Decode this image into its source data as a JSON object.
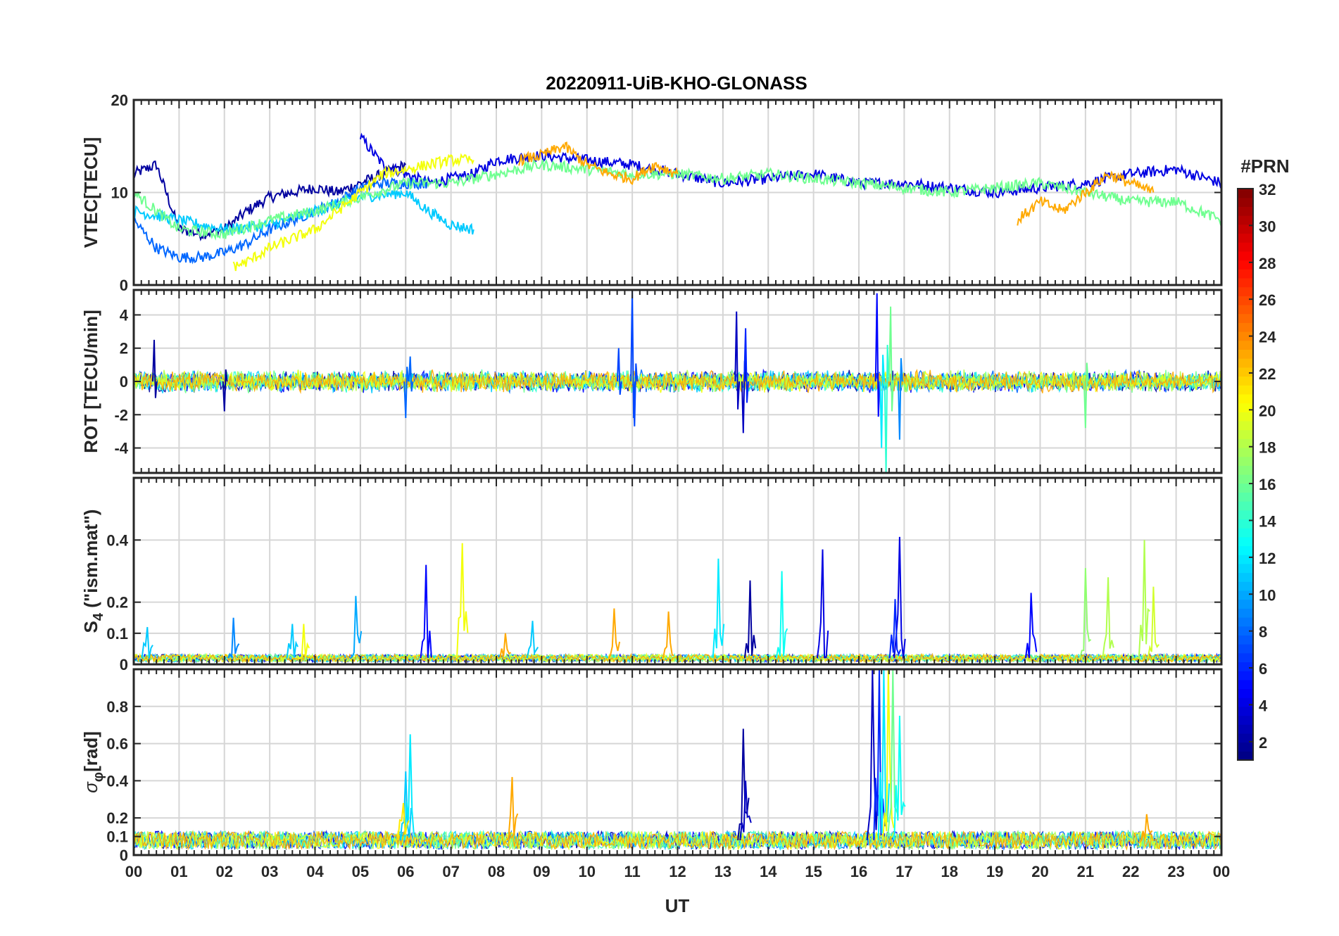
{
  "figure": {
    "title": "20220911-UiB-KHO-GLONASS",
    "xlabel": "UT",
    "x_tick_labels": [
      "00",
      "01",
      "02",
      "03",
      "04",
      "05",
      "06",
      "07",
      "08",
      "09",
      "10",
      "11",
      "12",
      "13",
      "14",
      "15",
      "16",
      "17",
      "18",
      "19",
      "20",
      "21",
      "22",
      "23",
      "00"
    ],
    "colorbar": {
      "title": "#PRN",
      "range": [
        1,
        32
      ],
      "tick_labels": [
        "2",
        "4",
        "6",
        "8",
        "10",
        "12",
        "14",
        "16",
        "18",
        "20",
        "22",
        "24",
        "26",
        "28",
        "30",
        "32"
      ],
      "colormap": "jet",
      "colors": [
        "#00008f",
        "#0000ff",
        "#0080ff",
        "#00ffff",
        "#80ff80",
        "#ffff00",
        "#ff8000",
        "#ff0000",
        "#800000"
      ]
    }
  },
  "chart_data": [
    {
      "type": "line",
      "name": "vtec",
      "ylabel": "VTEC[TECU]",
      "ylim": [
        0,
        20
      ],
      "y_ticks": [
        0,
        10,
        20
      ],
      "y_tick_labels": [
        "0",
        "10",
        "20"
      ],
      "grid": true,
      "x_unit": "hours UT",
      "series": [
        {
          "prn": 2,
          "x": [
            0,
            0.5,
            1,
            1.5,
            2,
            2.5,
            3,
            3.5,
            4,
            4.5,
            5,
            5.5,
            6
          ],
          "y": [
            12,
            13,
            6,
            5.5,
            6,
            8,
            9.5,
            10,
            10.5,
            10,
            11,
            12,
            13
          ]
        },
        {
          "prn": 4,
          "x": [
            5,
            5.5,
            6,
            6.5,
            7,
            7.5,
            8,
            9,
            10,
            11,
            12,
            13,
            14,
            15,
            16,
            17,
            18,
            19,
            20,
            21,
            22,
            23,
            24
          ],
          "y": [
            16,
            13,
            12,
            11,
            11.5,
            12,
            13.5,
            14,
            13.5,
            13,
            12,
            11,
            11.5,
            12,
            11,
            11,
            10.5,
            10,
            10.5,
            11,
            12,
            12.5,
            11
          ]
        },
        {
          "prn": 8,
          "x": [
            0,
            0.5,
            1,
            1.5,
            2,
            2.5,
            3,
            3.5,
            4,
            4.5,
            5,
            5.5,
            6,
            6.5
          ],
          "y": [
            7,
            4,
            3,
            3,
            3.5,
            4.5,
            6,
            7,
            8,
            9,
            10.5,
            11,
            11,
            11
          ]
        },
        {
          "prn": 11,
          "x": [
            0,
            1,
            2,
            3,
            4,
            5,
            6,
            6.5,
            7,
            7.5
          ],
          "y": [
            8,
            7,
            6,
            6.5,
            8,
            9.5,
            10,
            8,
            6.5,
            6
          ]
        },
        {
          "prn": 16,
          "x": [
            0,
            1,
            2,
            3,
            4,
            5,
            6,
            7,
            8,
            9,
            10,
            11,
            12,
            13,
            14,
            15,
            16,
            17,
            18,
            19,
            20,
            21,
            22,
            23,
            24
          ],
          "y": [
            10,
            6,
            5.5,
            7,
            8,
            9.5,
            11,
            11,
            12,
            13,
            12.5,
            12,
            12,
            11.5,
            12,
            11.5,
            11,
            10.5,
            10,
            10.5,
            11,
            10,
            9,
            9,
            7
          ]
        },
        {
          "prn": 20,
          "x": [
            2.2,
            2.5,
            3,
            3.5,
            4,
            4.5,
            5,
            5.5,
            6,
            6.5,
            7,
            7.5
          ],
          "y": [
            2,
            2.5,
            4,
            5,
            6,
            8,
            10,
            12,
            12.5,
            13,
            13.5,
            13.5
          ]
        },
        {
          "prn": 23,
          "x": [
            8.5,
            9,
            9.5,
            10,
            10.5,
            11,
            11.5,
            12
          ],
          "y": [
            13.5,
            14,
            15,
            13,
            12,
            11.5,
            13,
            12
          ]
        },
        {
          "prn": 23,
          "x": [
            19.5,
            20,
            20.5,
            21,
            21.5,
            22,
            22.5
          ],
          "y": [
            7,
            9,
            8,
            10,
            12,
            11,
            10
          ]
        }
      ]
    },
    {
      "type": "line",
      "name": "rot",
      "ylabel": "ROT [TECU/min]",
      "ylim": [
        -5.5,
        5.5
      ],
      "y_ticks": [
        -4,
        -2,
        0,
        2,
        4
      ],
      "y_tick_labels": [
        "-4",
        "-2",
        "0",
        "2",
        "4"
      ],
      "grid": true,
      "x_unit": "hours UT",
      "noise_amplitude": 0.45,
      "spikes": [
        {
          "x": 0.45,
          "y": 2.5,
          "prn": 2
        },
        {
          "x": 2.0,
          "y": -1.8,
          "prn": 2
        },
        {
          "x": 6.0,
          "y": -2.2,
          "prn": 8
        },
        {
          "x": 6.1,
          "y": 1.5,
          "prn": 8
        },
        {
          "x": 10.7,
          "y": 2.0,
          "prn": 7
        },
        {
          "x": 11.0,
          "y": 5.5,
          "prn": 7
        },
        {
          "x": 11.05,
          "y": -2.7,
          "prn": 7
        },
        {
          "x": 13.3,
          "y": 4.2,
          "prn": 3
        },
        {
          "x": 13.45,
          "y": -3.1,
          "prn": 3
        },
        {
          "x": 13.5,
          "y": 3.2,
          "prn": 6
        },
        {
          "x": 16.4,
          "y": 5.3,
          "prn": 5
        },
        {
          "x": 16.5,
          "y": -4.0,
          "prn": 12
        },
        {
          "x": 16.6,
          "y": -5.5,
          "prn": 14
        },
        {
          "x": 16.7,
          "y": 4.5,
          "prn": 16
        },
        {
          "x": 16.9,
          "y": -3.5,
          "prn": 9
        },
        {
          "x": 21.0,
          "y": -2.8,
          "prn": 16
        }
      ]
    },
    {
      "type": "line",
      "name": "s4",
      "ylabel": "S4 (\"ism.mat\")",
      "ylabel_parts": [
        "S",
        "4",
        " (\"ism.mat\")"
      ],
      "ylim": [
        0,
        0.6
      ],
      "y_ticks": [
        0,
        0.1,
        0.2,
        0.4
      ],
      "y_tick_labels": [
        "0",
        "0.1",
        "0.2",
        "0.4"
      ],
      "grid": true,
      "x_unit": "hours UT",
      "baseline": 0.02,
      "spikes": [
        {
          "x": 0.3,
          "y": 0.12,
          "prn": 11
        },
        {
          "x": 2.2,
          "y": 0.15,
          "prn": 9
        },
        {
          "x": 3.5,
          "y": 0.13,
          "prn": 11
        },
        {
          "x": 3.75,
          "y": 0.13,
          "prn": 20
        },
        {
          "x": 4.9,
          "y": 0.22,
          "prn": 10
        },
        {
          "x": 6.45,
          "y": 0.32,
          "prn": 5
        },
        {
          "x": 7.25,
          "y": 0.39,
          "prn": 20
        },
        {
          "x": 8.2,
          "y": 0.1,
          "prn": 23
        },
        {
          "x": 8.8,
          "y": 0.14,
          "prn": 11
        },
        {
          "x": 10.6,
          "y": 0.18,
          "prn": 23
        },
        {
          "x": 11.8,
          "y": 0.17,
          "prn": 23
        },
        {
          "x": 12.9,
          "y": 0.34,
          "prn": 12
        },
        {
          "x": 13.6,
          "y": 0.27,
          "prn": 2
        },
        {
          "x": 14.3,
          "y": 0.3,
          "prn": 13
        },
        {
          "x": 15.2,
          "y": 0.37,
          "prn": 4
        },
        {
          "x": 16.9,
          "y": 0.41,
          "prn": 4
        },
        {
          "x": 16.8,
          "y": 0.21,
          "prn": 6
        },
        {
          "x": 19.8,
          "y": 0.23,
          "prn": 5
        },
        {
          "x": 21.0,
          "y": 0.31,
          "prn": 17
        },
        {
          "x": 21.5,
          "y": 0.28,
          "prn": 18
        },
        {
          "x": 22.3,
          "y": 0.4,
          "prn": 18
        },
        {
          "x": 22.5,
          "y": 0.25,
          "prn": 19
        }
      ]
    },
    {
      "type": "line",
      "name": "sigma_phi",
      "ylabel": "σφ[rad]",
      "ylabel_parts": [
        "σ",
        "φ",
        "[rad]"
      ],
      "ylim": [
        0,
        1.0
      ],
      "y_ticks": [
        0,
        0.1,
        0.2,
        0.4,
        0.6,
        0.8
      ],
      "y_tick_labels": [
        "0",
        "0.1",
        "0.2",
        "0.4",
        "0.6",
        "0.8"
      ],
      "grid": true,
      "x_unit": "hours UT",
      "baseline": 0.08,
      "spikes": [
        {
          "x": 6.0,
          "y": 0.45,
          "prn": 11
        },
        {
          "x": 6.1,
          "y": 0.65,
          "prn": 12
        },
        {
          "x": 5.95,
          "y": 0.28,
          "prn": 21
        },
        {
          "x": 8.35,
          "y": 0.42,
          "prn": 23
        },
        {
          "x": 13.45,
          "y": 0.68,
          "prn": 2
        },
        {
          "x": 13.5,
          "y": 0.4,
          "prn": 3
        },
        {
          "x": 16.3,
          "y": 1.0,
          "prn": 3
        },
        {
          "x": 16.45,
          "y": 1.0,
          "prn": 6
        },
        {
          "x": 16.55,
          "y": 1.0,
          "prn": 12
        },
        {
          "x": 16.65,
          "y": 1.0,
          "prn": 20
        },
        {
          "x": 16.75,
          "y": 1.0,
          "prn": 16
        },
        {
          "x": 16.9,
          "y": 0.75,
          "prn": 13
        },
        {
          "x": 22.35,
          "y": 0.22,
          "prn": 23
        }
      ]
    }
  ]
}
